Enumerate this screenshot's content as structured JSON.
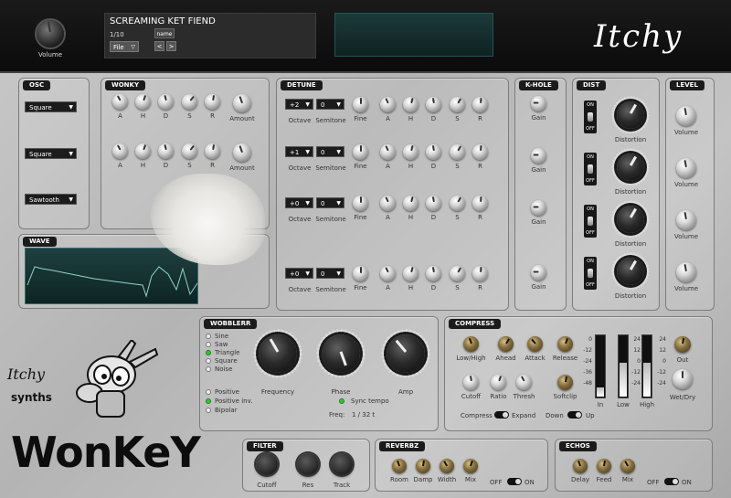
{
  "topbar": {
    "volume_label": "Volume",
    "preset_name": "SCREAMING KET FIEND",
    "preset_index": "1/10",
    "name_button": "name",
    "file_menu": "File",
    "prev": "<",
    "next": ">",
    "logo_text": "Itchy"
  },
  "osc": {
    "title": "OSC",
    "waves": [
      "Square",
      "Square",
      "Sawtooth"
    ]
  },
  "wonky": {
    "title": "WONKY",
    "knob_labels": [
      "A",
      "H",
      "D",
      "S",
      "R",
      "Amount"
    ]
  },
  "wave": {
    "title": "WAVE"
  },
  "detune": {
    "title": "DETUNE",
    "rows": [
      {
        "octave": "+2",
        "semitone": "0"
      },
      {
        "octave": "+1",
        "semitone": "0"
      },
      {
        "octave": "+0",
        "semitone": "0"
      },
      {
        "octave": "+0",
        "semitone": "0"
      }
    ],
    "octave_label": "Octave",
    "semitone_label": "Semitone",
    "knob_labels": [
      "Fine",
      "A",
      "H",
      "D",
      "S",
      "R"
    ]
  },
  "khole": {
    "title": "K-HOLE",
    "knob_label": "Gain"
  },
  "dist": {
    "title": "DIST",
    "knob_label": "Distortion",
    "on": "ON",
    "off": "OFF"
  },
  "level": {
    "title": "LEVEL",
    "knob_label": "Volume"
  },
  "wobblerr": {
    "title": "WOBBLERR",
    "shapes": [
      "Sine",
      "Saw",
      "Triangle",
      "Square",
      "Noise"
    ],
    "shape_selected": 2,
    "polarity": [
      "Positive",
      "Positive inv.",
      "Bipolar"
    ],
    "polarity_selected": 1,
    "knobs": [
      "Frequency",
      "Phase",
      "Amp"
    ],
    "sync_label": "Sync tempo",
    "freq_label": "Freq:",
    "freq_value": "1 / 32 t"
  },
  "compress": {
    "title": "COMPRESS",
    "top_knobs": [
      "Low/High",
      "Ahead",
      "Attack",
      "Release"
    ],
    "bottom_knobs": [
      "Cutoff",
      "Ratio",
      "Thresh",
      "Softclip"
    ],
    "meters": [
      "In",
      "Low",
      "High"
    ],
    "meter_levels": [
      0.15,
      0.55,
      0.55
    ],
    "scale": [
      "0",
      "-12",
      "-24",
      "-36",
      "-48"
    ],
    "scale_right": [
      "24",
      "12",
      "0",
      "-12",
      "-24"
    ],
    "out_label": "Out",
    "wetdry_label": "Wet/Dry",
    "compress_label": "Compress",
    "expand_label": "Expand",
    "down_label": "Down",
    "up_label": "Up"
  },
  "brand": {
    "line1": "Itchy",
    "line2": "synths",
    "product": "WonKeY"
  },
  "filter": {
    "title": "FILTER",
    "knobs": [
      "Cutoff",
      "Res",
      "Track"
    ]
  },
  "reverbz": {
    "title": "REVERBZ",
    "knobs": [
      "Room",
      "Damp",
      "Width",
      "Mix"
    ],
    "off": "OFF",
    "on": "ON"
  },
  "echos": {
    "title": "ECHOS",
    "knobs": [
      "Delay",
      "Feed",
      "Mix"
    ],
    "off": "OFF",
    "on": "ON"
  }
}
